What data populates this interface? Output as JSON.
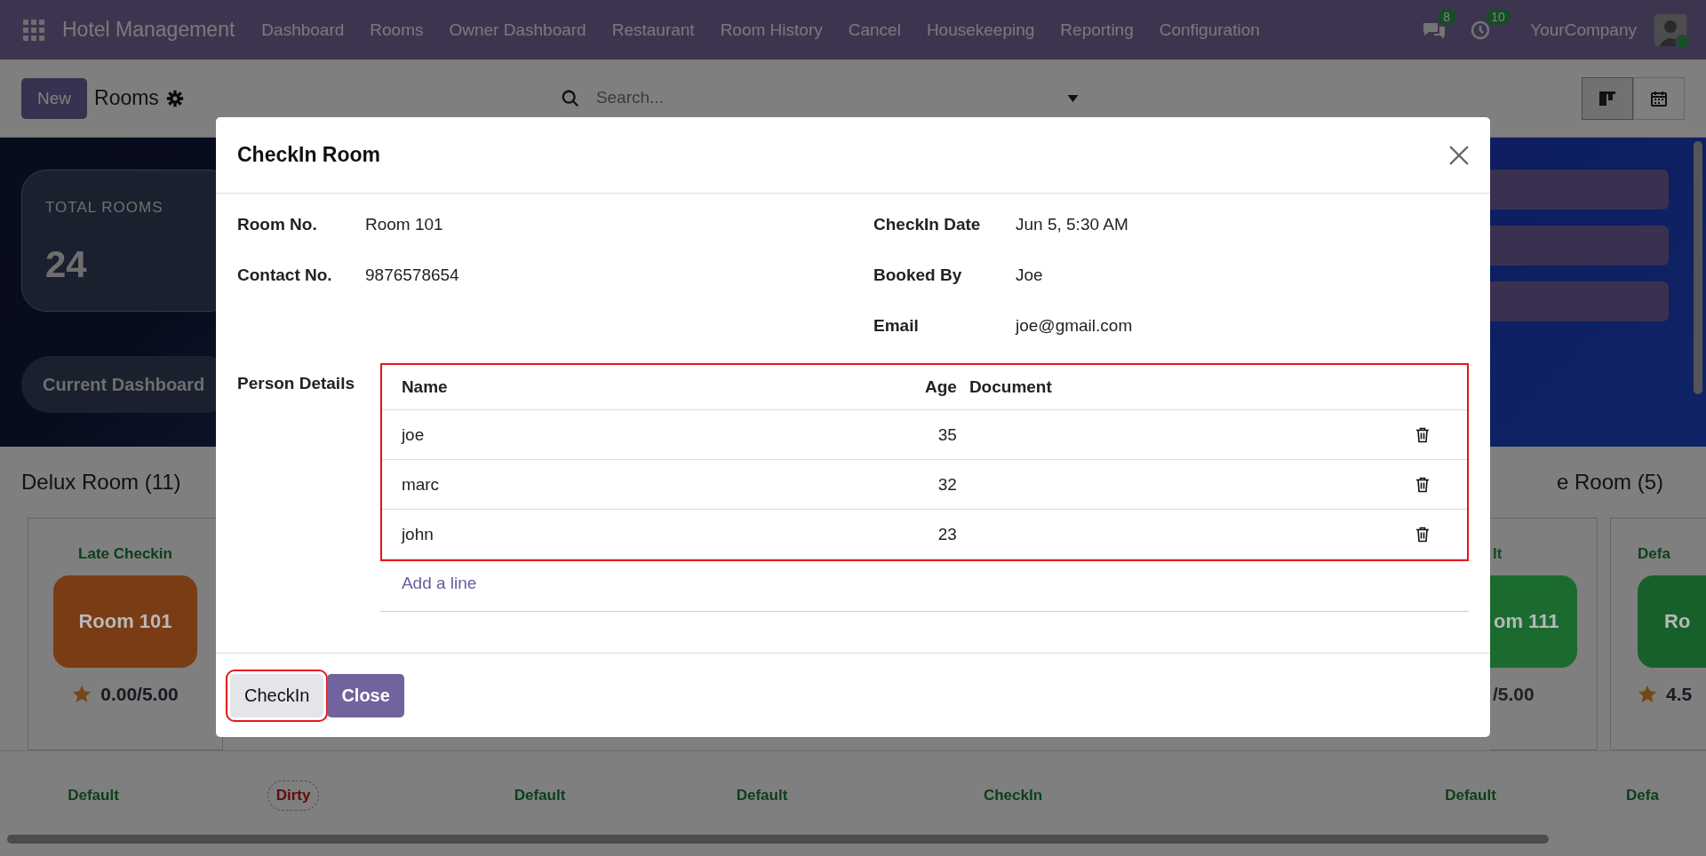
{
  "navbar": {
    "app_title": "Hotel Management",
    "menu": [
      "Dashboard",
      "Rooms",
      "Owner Dashboard",
      "Restaurant",
      "Room History",
      "Cancel",
      "Housekeeping",
      "Reporting",
      "Configuration"
    ],
    "messages_badge": "8",
    "activities_badge": "10",
    "company": "YourCompany"
  },
  "control_panel": {
    "new_button": "New",
    "title": "Rooms",
    "search": {
      "placeholder": "Search..."
    },
    "views": [
      {
        "kind": "kanban",
        "selected": true
      },
      {
        "kind": "calendar",
        "selected": false
      }
    ]
  },
  "background": {
    "stat_card": {
      "label": "TOTAL ROOMS",
      "value": "24"
    },
    "dashboard_button": "Current Dashboard",
    "groups": [
      {
        "title": "Delux Room (11)"
      },
      {
        "title": "e Room (5)"
      }
    ],
    "cards": [
      {
        "status": "Late Checkin",
        "room": "Room 101",
        "color": "#7a3c14",
        "star": true,
        "rating": "0.00/5.00"
      },
      {
        "status": "lt",
        "room": "om 111",
        "color": "#1b6b30",
        "star": false,
        "rating": "/5.00"
      },
      {
        "status": "Defa",
        "room": "Ro",
        "color": "#17602b",
        "star": true,
        "rating": "4.5"
      }
    ],
    "bottom_statuses": [
      {
        "label": "Default",
        "kind": "default"
      },
      {
        "label": "Dirty",
        "kind": "dirty"
      },
      {
        "label": "Default",
        "kind": "default"
      },
      {
        "label": "Default",
        "kind": "default"
      },
      {
        "label": "CheckIn",
        "kind": "default"
      },
      {
        "label": "Default",
        "kind": "default"
      },
      {
        "label": "Defa",
        "kind": "default"
      }
    ]
  },
  "dialog": {
    "title": "CheckIn Room",
    "left_fields": [
      {
        "label": "Room No.",
        "value": "Room 101"
      },
      {
        "label": "Contact No.",
        "value": "9876578654"
      }
    ],
    "right_fields": [
      {
        "label": "CheckIn Date",
        "value": "Jun 5, 5:30 AM"
      },
      {
        "label": "Booked By",
        "value": "Joe"
      },
      {
        "label": "Email",
        "value": "joe@gmail.com"
      }
    ],
    "person_details": {
      "label": "Person Details",
      "highlighted": true,
      "columns": [
        "Name",
        "Age",
        "Document"
      ],
      "rows": [
        {
          "name": "joe",
          "age": "35"
        },
        {
          "name": "marc",
          "age": "32"
        },
        {
          "name": "john",
          "age": "23"
        }
      ],
      "add_line": "Add a line"
    },
    "buttons": [
      {
        "label": "CheckIn",
        "kind": "secondary",
        "highlighted": true
      },
      {
        "label": "Close",
        "kind": "primary",
        "highlighted": false
      }
    ]
  }
}
